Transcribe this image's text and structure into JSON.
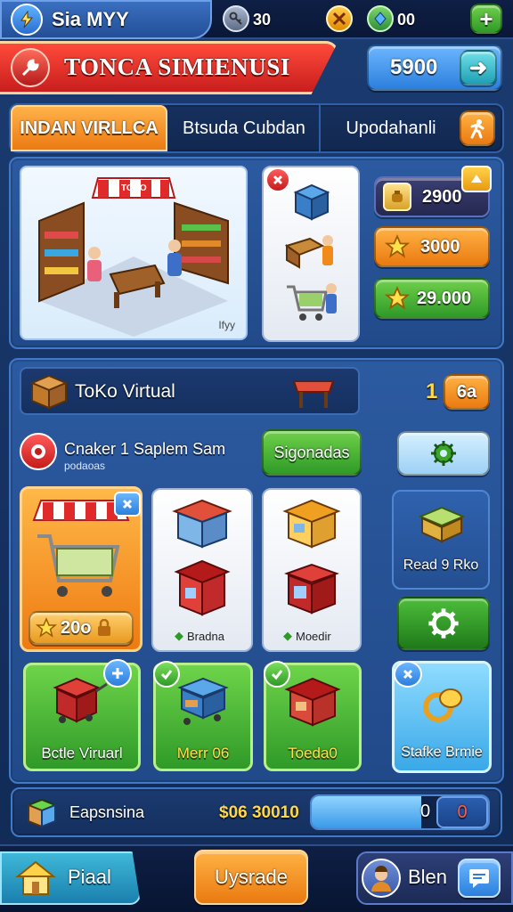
{
  "topbar": {
    "player_name": "Sia MYY",
    "resource_a": "30",
    "resource_b": "00",
    "plus_label": "+"
  },
  "header": {
    "title": "TONCA SIMIENUSI",
    "currency_value": "5900",
    "currency_arrow": "➜"
  },
  "tabs": [
    {
      "label": "INDAN VIRLLCA",
      "active": true
    },
    {
      "label": "Btsuda Cubdan",
      "active": false
    },
    {
      "label": "Upodahanli",
      "active": false
    }
  ],
  "preview": {
    "banner_text": "TOKO",
    "corner_label": "Ifyy"
  },
  "price_rows": [
    {
      "value": "2900",
      "color": "dark"
    },
    {
      "value": "3000",
      "color": "orange"
    },
    {
      "value": "29.000",
      "color": "green"
    }
  ],
  "store_bar": {
    "name": "ToKo Virtual",
    "count": "1",
    "count_badge": "6a"
  },
  "section": {
    "title": "Cnaker 1 Saplem Sam",
    "subtitle": "podaoas",
    "action_button": "Sigonadas"
  },
  "cards_top": [
    {
      "price": "20o"
    },
    {
      "label": "Bradna"
    },
    {
      "label": "Moedir"
    }
  ],
  "side_top": {
    "label": "Read 9 Rko"
  },
  "cards_bottom": [
    {
      "label": "Bctle Viruarl"
    },
    {
      "label": "Merr 06"
    },
    {
      "label": "Toeda0"
    }
  ],
  "side_bottom": {
    "label": "Stafke Brmie"
  },
  "progress": {
    "label": "Eapsnsina",
    "value": "$06 30010",
    "slot_a": "0",
    "slot_b": "0",
    "fill_fraction": 0.62
  },
  "bottom_nav": {
    "left_label": "Piaal",
    "center_label": "Uysrade",
    "right_label": "Blen"
  },
  "colors": {
    "background": "#163263",
    "title_red": "#d9261f",
    "accent_orange": "#f08a18",
    "accent_green": "#3aa52b",
    "accent_blue": "#2b7fdc"
  }
}
